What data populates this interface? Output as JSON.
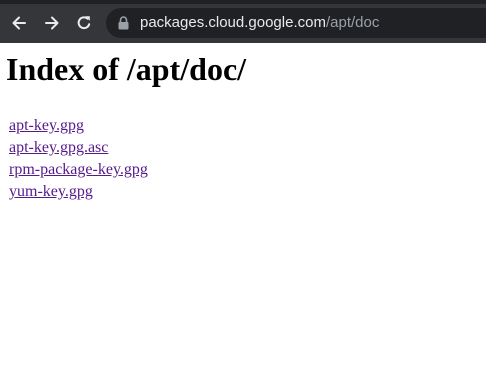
{
  "browser": {
    "url_host": "packages.cloud.google.com",
    "url_path": "/apt/doc"
  },
  "page": {
    "title": "Index of /apt/doc/",
    "links": [
      {
        "label": "apt-key.gpg"
      },
      {
        "label": "apt-key.gpg.asc"
      },
      {
        "label": "rpm-package-key.gpg"
      },
      {
        "label": "yum-key.gpg"
      }
    ]
  },
  "colors": {
    "toolbar": "#35363a",
    "omnibox": "#202124",
    "visited_link": "#551a8b"
  }
}
